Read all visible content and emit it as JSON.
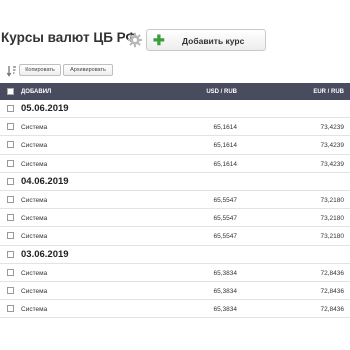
{
  "header": {
    "title": "Курсы валют ЦБ РФ",
    "add_button_label": "Добавить курс",
    "add_button_icon": "plus-icon",
    "settings_icon": "gear-icon"
  },
  "toolbar": {
    "sort_icon": "sort-icon",
    "copy_label": "Копировать",
    "archive_label": "Архивировать"
  },
  "table": {
    "columns": {
      "added": "ДОБАВИЛ",
      "usd": "USD / RUB",
      "eur": "EUR / RUB"
    },
    "groups": [
      {
        "date": "05.06.2019",
        "rows": [
          {
            "added": "Система",
            "usd": "65,1614",
            "eur": "73,4239"
          },
          {
            "added": "Система",
            "usd": "65,1614",
            "eur": "73,4239"
          },
          {
            "added": "Система",
            "usd": "65,1614",
            "eur": "73,4239"
          }
        ]
      },
      {
        "date": "04.06.2019",
        "rows": [
          {
            "added": "Система",
            "usd": "65,5547",
            "eur": "73,2180"
          },
          {
            "added": "Система",
            "usd": "65,5547",
            "eur": "73,2180"
          },
          {
            "added": "Система",
            "usd": "65,5547",
            "eur": "73,2180"
          }
        ]
      },
      {
        "date": "03.06.2019",
        "rows": [
          {
            "added": "Система",
            "usd": "65,3834",
            "eur": "72,8436"
          },
          {
            "added": "Система",
            "usd": "65,3834",
            "eur": "72,8436"
          },
          {
            "added": "Система",
            "usd": "65,3834",
            "eur": "72,8436"
          }
        ]
      }
    ]
  },
  "colors": {
    "header_bg": "#494b5e",
    "add_icon": "#3a9e3a",
    "gear_icon": "#b9b9b9"
  }
}
